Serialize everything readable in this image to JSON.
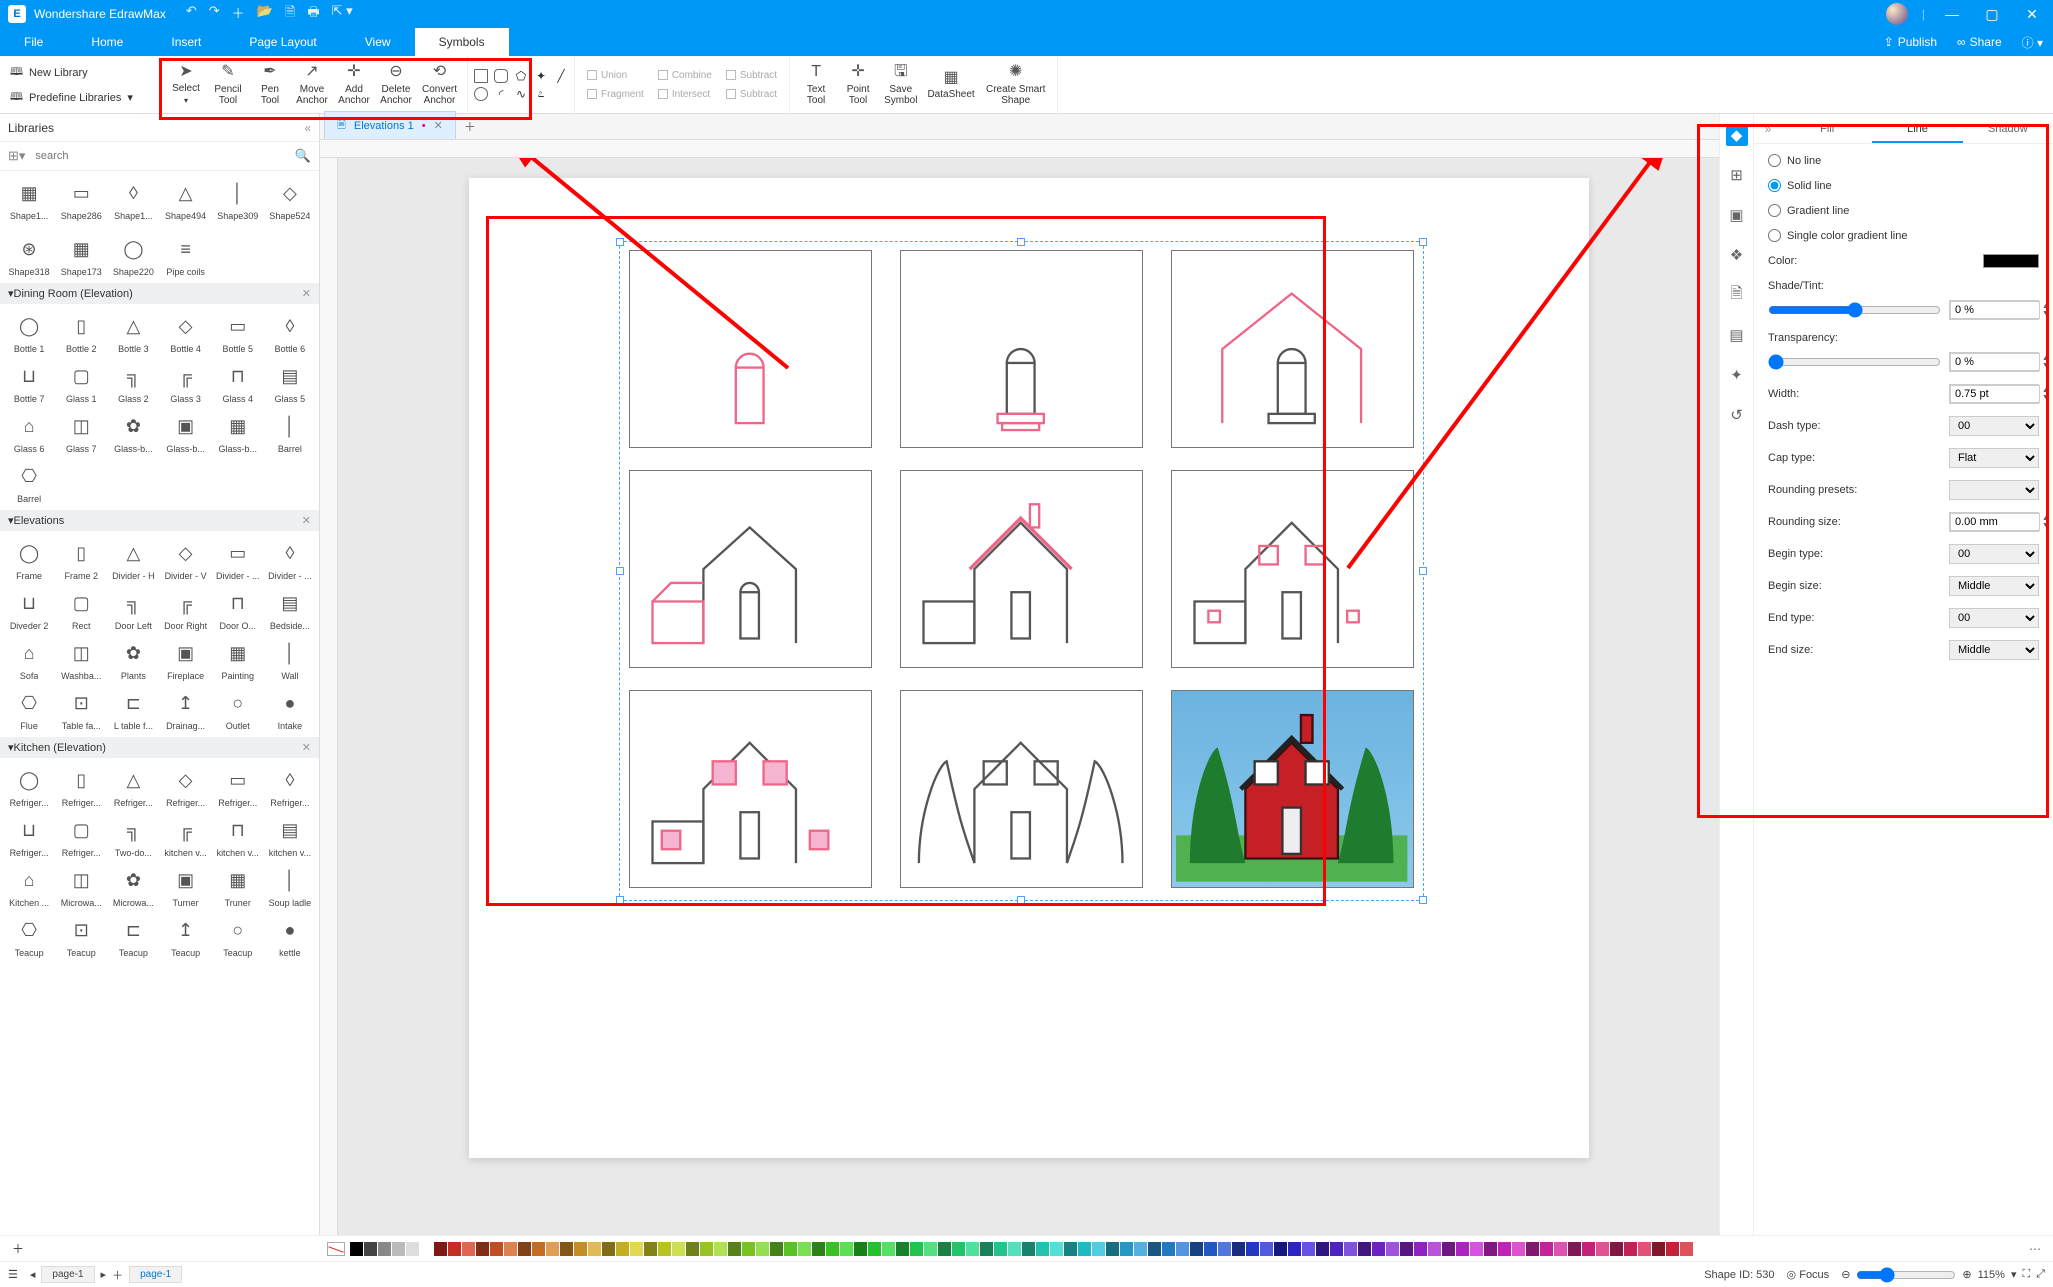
{
  "app": {
    "title": "Wondershare EdrawMax"
  },
  "titlebar": {
    "publish": "Publish",
    "share": "Share"
  },
  "menu": {
    "items": [
      "File",
      "Home",
      "Insert",
      "Page Layout",
      "View",
      "Symbols"
    ],
    "active_index": 5
  },
  "ribbon_left": {
    "new_library": "New Library",
    "predefine": "Predefine Libraries"
  },
  "ribbon": {
    "select": "Select",
    "pencil": "Pencil\nTool",
    "pen": "Pen\nTool",
    "move_anchor": "Move\nAnchor",
    "add_anchor": "Add\nAnchor",
    "delete_anchor": "Delete\nAnchor",
    "convert_anchor": "Convert\nAnchor",
    "union": "Union",
    "combine": "Combine",
    "subtract": "Subtract",
    "fragment": "Fragment",
    "intersect": "Intersect",
    "subtract2": "Subtract",
    "text_tool": "Text\nTool",
    "point_tool": "Point\nTool",
    "save_symbol": "Save\nSymbol",
    "datasheet": "DataSheet",
    "smart_shape": "Create Smart\nShape"
  },
  "libraries": {
    "title": "Libraries",
    "search_placeholder": "search",
    "row0": [
      "Shape1...",
      "Shape286",
      "Shape1...",
      "Shape494",
      "Shape309",
      "Shape524"
    ],
    "row0b": [
      "Shape318",
      "Shape173",
      "Shape220",
      "Pipe coils"
    ],
    "sections": [
      {
        "name": "Dining Room (Elevation)",
        "items": [
          "Bottle 1",
          "Bottle 2",
          "Bottle 3",
          "Bottle 4",
          "Bottle 5",
          "Bottle 6",
          "Bottle 7",
          "Glass 1",
          "Glass 2",
          "Glass 3",
          "Glass 4",
          "Glass 5",
          "Glass 6",
          "Glass 7",
          "Glass-b...",
          "Glass-b...",
          "Glass-b...",
          "Barrel",
          "Barrel"
        ]
      },
      {
        "name": "Elevations",
        "items": [
          "Frame",
          "Frame 2",
          "Divider - H",
          "Divider - V",
          "Divider - ...",
          "Divider - ...",
          "Diveder 2",
          "Rect",
          "Door Left",
          "Door Right",
          "Door O...",
          "Bedside...",
          "Sofa",
          "Washba...",
          "Plants",
          "Fireplace",
          "Painting",
          "Wall",
          "Flue",
          "Table fa...",
          "L table f...",
          "Drainag...",
          "Outlet",
          "Intake"
        ]
      },
      {
        "name": "Kitchen (Elevation)",
        "items": [
          "Refriger...",
          "Refriger...",
          "Refriger...",
          "Refriger...",
          "Refriger...",
          "Refriger...",
          "Refriger...",
          "Refriger...",
          "Two-do...",
          "kitchen v...",
          "kitchen v...",
          "kitchen v...",
          "Kitchen ...",
          "Microwa...",
          "Microwa...",
          "Turner",
          "Truner",
          "Soup ladle",
          "Teacup",
          "Teacup",
          "Teacup",
          "Teacup",
          "Teacup",
          "kettle"
        ]
      }
    ]
  },
  "doc_tabs": {
    "active": "Elevations 1"
  },
  "right_tabs": {
    "fill": "Fill",
    "line": "Line",
    "shadow": "Shadow",
    "active": "line"
  },
  "line_panel": {
    "no_line": "No line",
    "solid_line": "Solid line",
    "gradient_line": "Gradient line",
    "single_gradient": "Single color gradient line",
    "color_label": "Color:",
    "shade_label": "Shade/Tint:",
    "shade_val": "0 %",
    "transparency_label": "Transparency:",
    "transparency_val": "0 %",
    "width_label": "Width:",
    "width_val": "0.75 pt",
    "dash_label": "Dash type:",
    "dash_val": "00",
    "cap_label": "Cap type:",
    "cap_val": "Flat",
    "rounding_presets_label": "Rounding presets:",
    "rounding_size_label": "Rounding size:",
    "rounding_size_val": "0.00 mm",
    "begin_type_label": "Begin type:",
    "begin_type_val": "00",
    "begin_size_label": "Begin size:",
    "begin_size_val": "Middle",
    "end_type_label": "End type:",
    "end_type_val": "00",
    "end_size_label": "End size:",
    "end_size_val": "Middle"
  },
  "status": {
    "page_left": "page-1",
    "page_right": "page-1",
    "shape_id": "Shape ID: 530",
    "focus": "Focus",
    "zoom": "115%"
  },
  "colors": {
    "accent": "#0098f7",
    "highlight": "#ff0000"
  }
}
